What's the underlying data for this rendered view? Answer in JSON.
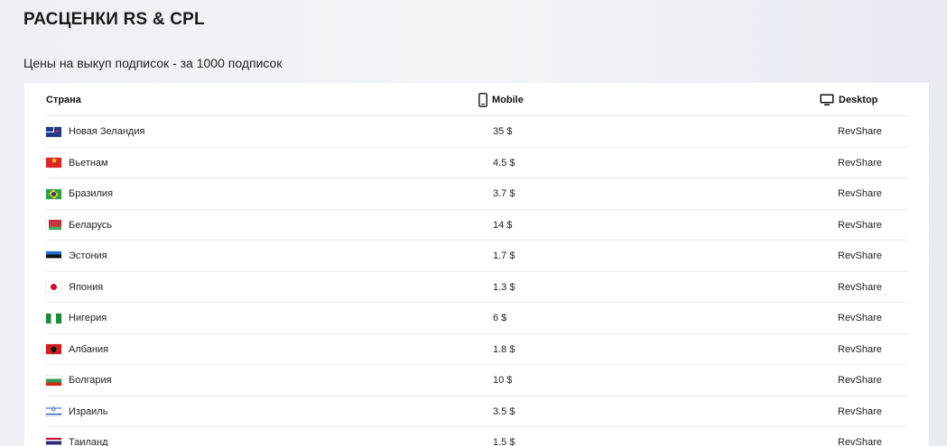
{
  "page": {
    "title": "РАСЦЕНКИ RS & CPL",
    "subtitle": "Цены на выкуп подписок - за 1000 подписок"
  },
  "table": {
    "headers": {
      "country": "Страна",
      "mobile": "Mobile",
      "desktop": "Desktop"
    },
    "header_icons": {
      "mobile": "smartphone-icon",
      "desktop": "monitor-icon"
    },
    "rows": [
      {
        "flag": "nz",
        "country": "Новая Зеландия",
        "mobile": "35 $",
        "desktop": "RevShare"
      },
      {
        "flag": "vn",
        "country": "Вьетнам",
        "mobile": "4.5 $",
        "desktop": "RevShare"
      },
      {
        "flag": "br",
        "country": "Бразилия",
        "mobile": "3.7 $",
        "desktop": "RevShare"
      },
      {
        "flag": "by",
        "country": "Беларусь",
        "mobile": "14 $",
        "desktop": "RevShare"
      },
      {
        "flag": "ee",
        "country": "Эстония",
        "mobile": "1.7 $",
        "desktop": "RevShare"
      },
      {
        "flag": "jp",
        "country": "Япония",
        "mobile": "1.3 $",
        "desktop": "RevShare"
      },
      {
        "flag": "ng",
        "country": "Нигерия",
        "mobile": "6 $",
        "desktop": "RevShare"
      },
      {
        "flag": "al",
        "country": "Албания",
        "mobile": "1.8 $",
        "desktop": "RevShare"
      },
      {
        "flag": "bg",
        "country": "Болгария",
        "mobile": "10 $",
        "desktop": "RevShare"
      },
      {
        "flag": "il",
        "country": "Израиль",
        "mobile": "3.5 $",
        "desktop": "RevShare"
      },
      {
        "flag": "th",
        "country": "Таиланд",
        "mobile": "1.5 $",
        "desktop": "RevShare"
      }
    ]
  }
}
